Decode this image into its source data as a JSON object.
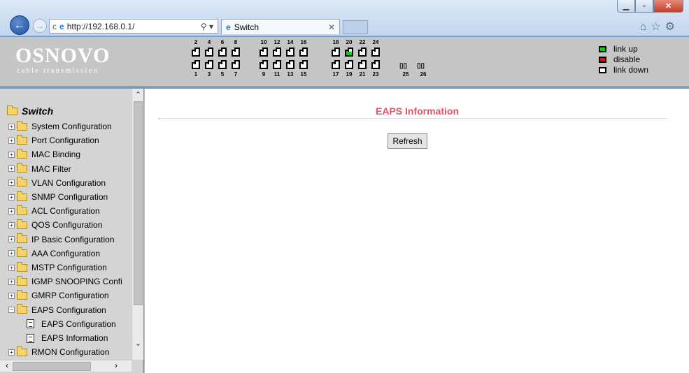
{
  "browser": {
    "address": "http://192.168.0.1/",
    "tab_title": "Switch",
    "window_controls": [
      "minimize-icon",
      "restore-icon",
      "close-icon"
    ],
    "toolbar_icons": [
      "home-icon",
      "favorites-star-icon",
      "settings-gear-icon"
    ]
  },
  "header": {
    "logo": "OSNOVO",
    "tagline": "cable transmission",
    "ports_top": [
      "2",
      "4",
      "6",
      "8",
      "10",
      "12",
      "14",
      "16",
      "18",
      "20",
      "22",
      "24"
    ],
    "ports_bottom": [
      "1",
      "3",
      "5",
      "7",
      "9",
      "11",
      "13",
      "15",
      "17",
      "19",
      "21",
      "23"
    ],
    "sfp_ports": [
      "25",
      "26"
    ],
    "port_20_status": "link up",
    "legend": [
      {
        "label": "link up",
        "color": "#18c818"
      },
      {
        "label": "disable",
        "color": "#e01010"
      },
      {
        "label": "link down",
        "color": "#ffffff"
      }
    ]
  },
  "sidebar": {
    "root": "Switch",
    "items": [
      "System Configuration",
      "Port Configuration",
      "MAC Binding",
      "MAC Filter",
      "VLAN Configuration",
      "SNMP Configuration",
      "ACL Configuration",
      "QOS Configuration",
      "IP Basic Configuration",
      "AAA Configuration",
      "MSTP Configuration",
      "IGMP SNOOPING Confi",
      "GMRP Configuration",
      "EAPS Configuration"
    ],
    "subitems": [
      "EAPS Configuration",
      "EAPS Information"
    ],
    "after": "RMON Configuration"
  },
  "main": {
    "title": "EAPS Information",
    "refresh_label": "Refresh"
  },
  "colors": {
    "title": "#e8506c",
    "header_bg": "#c6c6c6",
    "sidebar_bg": "#d4d4d4"
  }
}
